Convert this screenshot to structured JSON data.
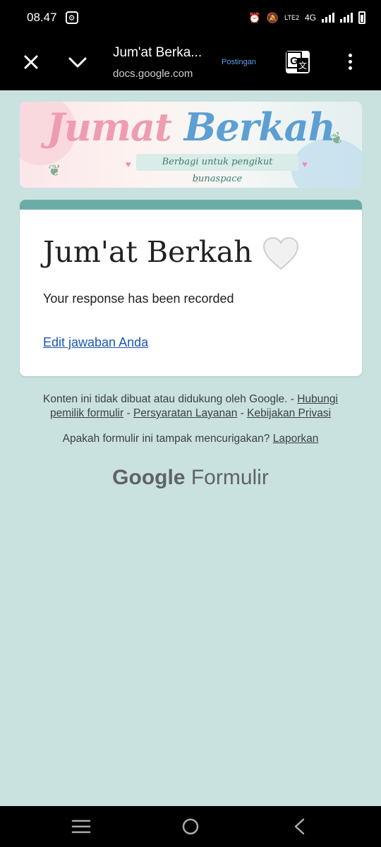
{
  "status_bar": {
    "time": "08.47",
    "network": "4G",
    "volte": "LTE2"
  },
  "app_bar": {
    "title": "Jum'at Berka...",
    "url": "docs.google.com",
    "badge": "Postingan"
  },
  "banner": {
    "title_word1": "Jumat",
    "title_word2": "Berkah",
    "subtitle": "Berbagi untuk pengikut bunaspace"
  },
  "card": {
    "title": "Jum'at Berkah",
    "message": "Your response has been recorded",
    "edit_link": "Edit jawaban Anda",
    "accent_color": "#6bada6"
  },
  "footer": {
    "disclaimer": "Konten ini tidak dibuat atau didukung oleh Google. -",
    "contact_link": "Hubungi pemilik formulir",
    "sep1": "-",
    "terms_link": "Persyaratan Layanan",
    "sep2": "-",
    "privacy_link": "Kebijakan Privasi",
    "report_prompt": "Apakah formulir ini tampak mencurigakan?",
    "report_link": "Laporkan"
  },
  "logo": {
    "brand": "Google",
    "product": "Formulir"
  }
}
